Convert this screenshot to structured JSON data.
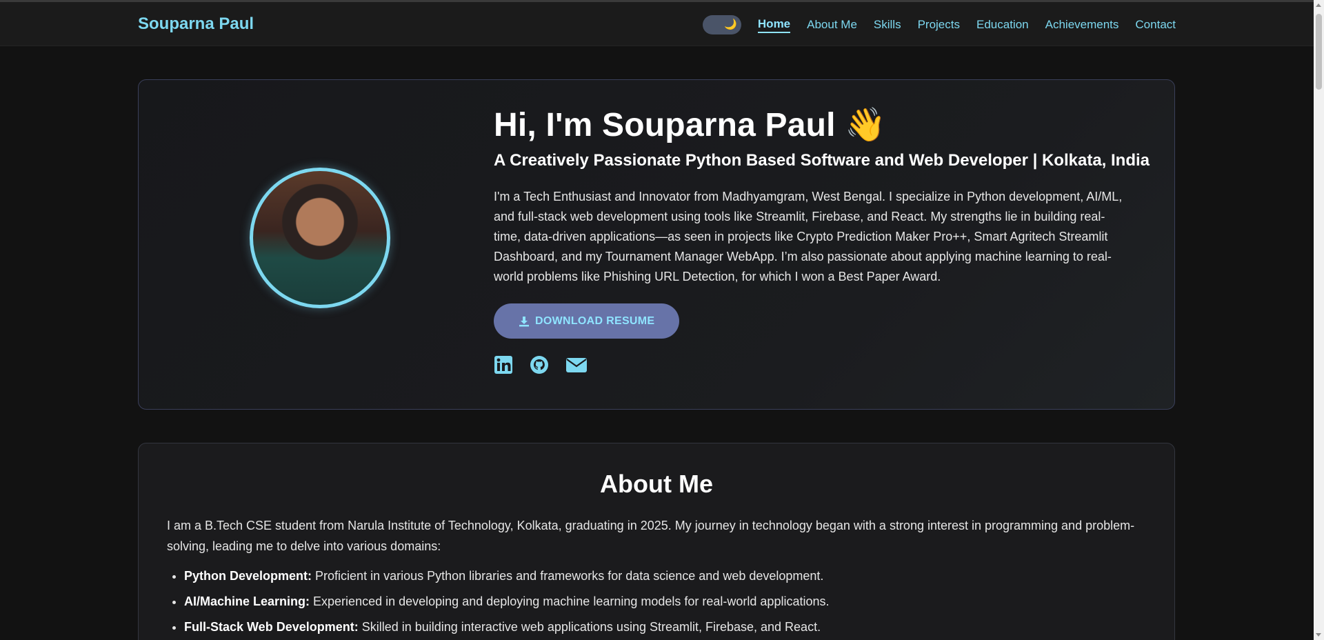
{
  "brand": "Souparna Paul",
  "theme_toggle": {
    "icon": "moon-icon",
    "glyph": "🌙"
  },
  "nav": {
    "items": [
      {
        "label": "Home",
        "active": true
      },
      {
        "label": "About Me"
      },
      {
        "label": "Skills"
      },
      {
        "label": "Projects"
      },
      {
        "label": "Education"
      },
      {
        "label": "Achievements"
      },
      {
        "label": "Contact"
      }
    ]
  },
  "hero": {
    "title": "Hi, I'm Souparna Paul 👋",
    "subtitle": "A Creatively Passionate Python Based Software and Web Developer | Kolkata, India",
    "description": "I'm a Tech Enthusiast and Innovator from Madhyamgram, West Bengal. I specialize in Python development, AI/ML, and full-stack web development using tools like Streamlit, Firebase, and React. My strengths lie in building real-time, data-driven applications—as seen in projects like Crypto Prediction Maker Pro++, Smart Agritech Streamlit Dashboard, and my Tournament Manager WebApp. I’m also passionate about applying machine learning to real-world problems like Phishing URL Detection, for which I won a Best Paper Award.",
    "resume_button": "DOWNLOAD RESUME",
    "socials": [
      "linkedin-icon",
      "github-icon",
      "email-icon"
    ]
  },
  "about": {
    "title": "About Me",
    "intro": "I am a B.Tech CSE student from Narula Institute of Technology, Kolkata, graduating in 2025. My journey in technology began with a strong interest in programming and problem-solving, leading me to delve into various domains:",
    "items": [
      {
        "term": "Python Development:",
        "text": " Proficient in various Python libraries and frameworks for data science and web development."
      },
      {
        "term": "AI/Machine Learning:",
        "text": " Experienced in developing and deploying machine learning models for real-world applications."
      },
      {
        "term": "Full-Stack Web Development:",
        "text": " Skilled in building interactive web applications using Streamlit, Firebase, and React."
      }
    ]
  },
  "colors": {
    "accent": "#7dd8f0",
    "button_bg": "#6773a8",
    "background": "#121212"
  }
}
